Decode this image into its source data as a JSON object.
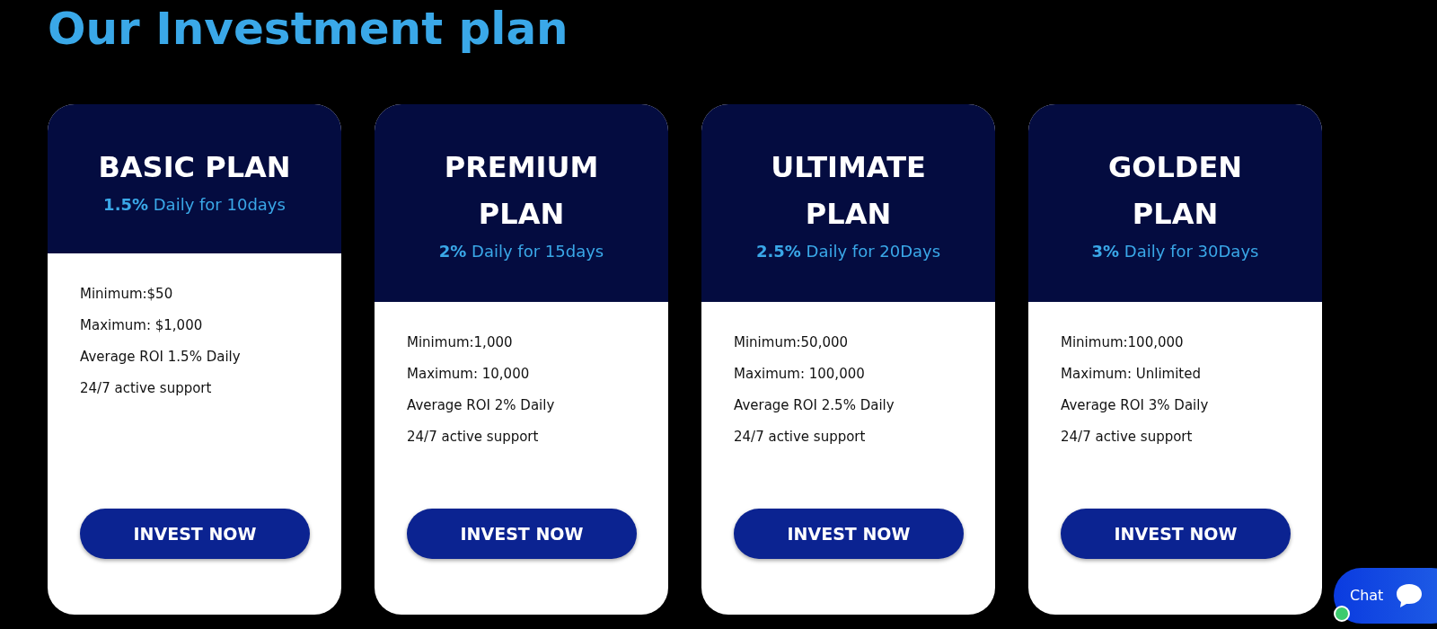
{
  "heading": "Our Investment plan",
  "plans": [
    {
      "title_lines": [
        "BASIC PLAN"
      ],
      "rate": "**1.5%** Daily for 10days",
      "features": [
        "Minimum:$50",
        "Maximum: $1,000",
        "Average ROI 1.5% Daily",
        "24/7 active support"
      ],
      "button": "INVEST NOW"
    },
    {
      "title_lines": [
        "PREMIUM",
        "PLAN"
      ],
      "rate": "**2%** Daily for 15days",
      "features": [
        "Minimum:1,000",
        "Maximum: 10,000",
        "Average ROI 2% Daily",
        "24/7 active support"
      ],
      "button": "INVEST NOW"
    },
    {
      "title_lines": [
        "ULTIMATE",
        "PLAN"
      ],
      "rate": "**2.5%** Daily for 20Days",
      "features": [
        "Minimum:50,000",
        "Maximum: 100,000",
        "Average ROI 2.5% Daily",
        "24/7 active support"
      ],
      "button": "INVEST NOW"
    },
    {
      "title_lines": [
        "GOLDEN",
        "PLAN"
      ],
      "rate": "**3%** Daily for 30Days",
      "features": [
        "Minimum:100,000",
        "Maximum: Unlimited",
        "Average ROI 3% Daily",
        "24/7 active support"
      ],
      "button": "INVEST NOW"
    }
  ],
  "chat": {
    "label": "Chat",
    "online": true
  }
}
